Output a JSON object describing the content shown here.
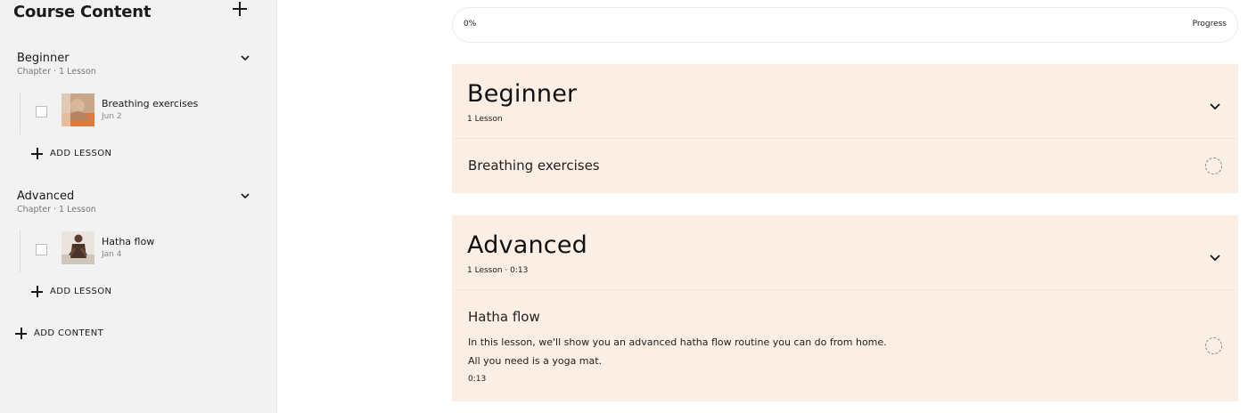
{
  "sidebar": {
    "title": "Course Content",
    "chapters": [
      {
        "title": "Beginner",
        "meta": "Chapter · 1 Lesson",
        "lesson": {
          "name": "Breathing exercises",
          "date": "Jun 2"
        },
        "add_lesson": "ADD LESSON"
      },
      {
        "title": "Advanced",
        "meta": "Chapter · 1 Lesson",
        "lesson": {
          "name": "Hatha flow",
          "date": "Jan 4"
        },
        "add_lesson": "ADD LESSON"
      }
    ],
    "add_content": "ADD CONTENT"
  },
  "progress": {
    "percent_label": "0%",
    "label": "Progress",
    "value": 0
  },
  "main": {
    "chapters": [
      {
        "title": "Beginner",
        "meta": "1 Lesson",
        "lessons": [
          {
            "title": "Breathing exercises"
          }
        ]
      },
      {
        "title": "Advanced",
        "meta": "1 Lesson · 0:13",
        "lessons": [
          {
            "title": "Hatha flow",
            "description": "In this lesson, we'll show you an advanced hatha flow routine you can do from home. All you need is a yoga mat.",
            "duration": "0:13"
          }
        ]
      }
    ]
  },
  "colors": {
    "sidebar_bg": "#f2f2f2",
    "card_bg": "#fbeee5",
    "text": "#1a1a1a"
  },
  "icons": {
    "add": "plus-icon",
    "expand": "chevron-down-icon",
    "status": "dashed-circle-icon"
  }
}
